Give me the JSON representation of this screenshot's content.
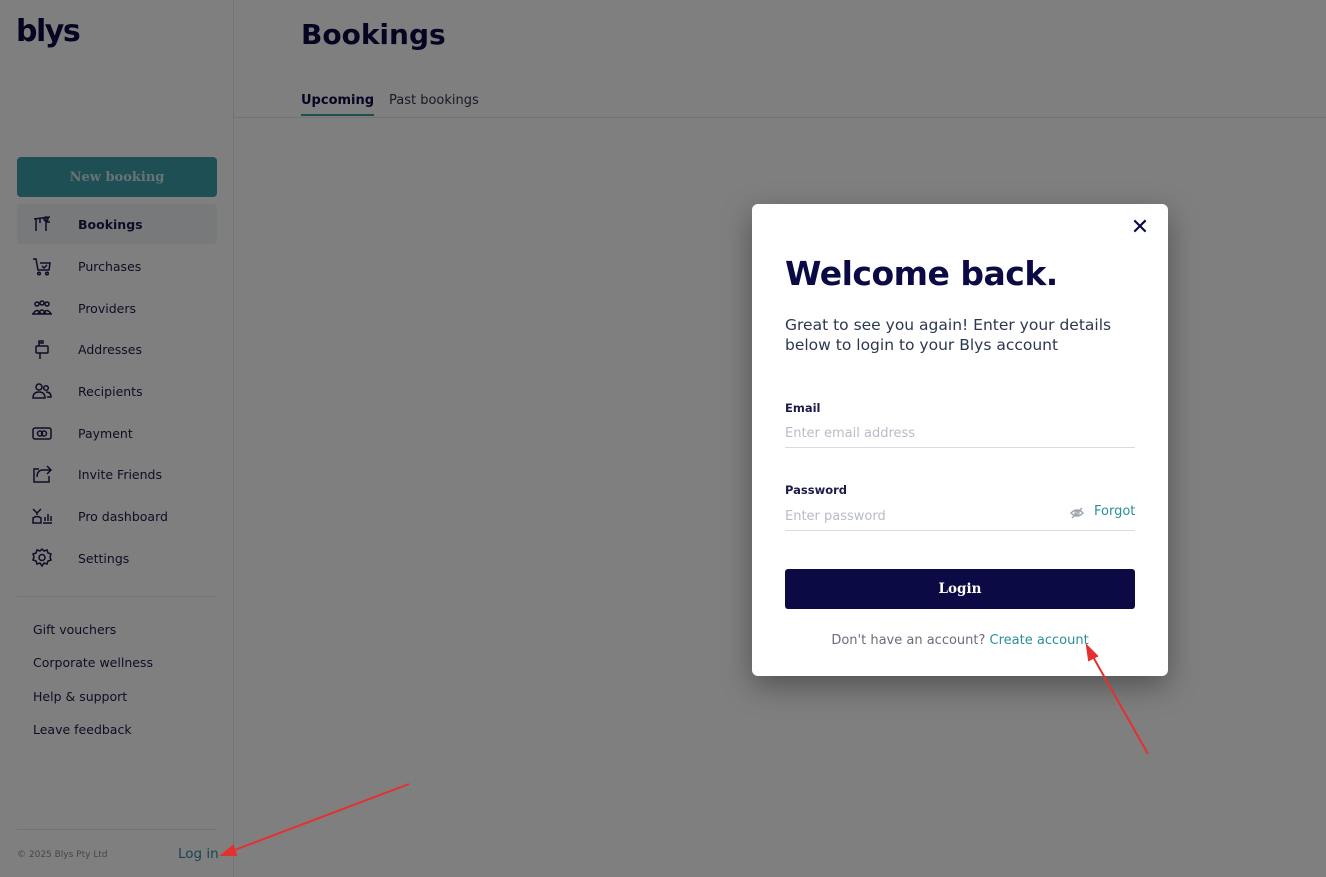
{
  "sidebar": {
    "logo": "blys",
    "new_booking": "New booking",
    "nav": [
      {
        "label": "Bookings",
        "icon": "bookings-icon",
        "active": true
      },
      {
        "label": "Purchases",
        "icon": "cart-icon"
      },
      {
        "label": "Providers",
        "icon": "providers-icon"
      },
      {
        "label": "Addresses",
        "icon": "mailbox-icon"
      },
      {
        "label": "Recipients",
        "icon": "recipients-icon"
      },
      {
        "label": "Payment",
        "icon": "payment-icon"
      },
      {
        "label": "Invite Friends",
        "icon": "share-icon"
      },
      {
        "label": "Pro dashboard",
        "icon": "dashboard-icon"
      },
      {
        "label": "Settings",
        "icon": "gear-icon"
      }
    ],
    "links": [
      "Gift vouchers",
      "Corporate wellness",
      "Help & support",
      "Leave feedback"
    ],
    "copyright": "© 2025 Blys Pty Ltd",
    "login": "Log in"
  },
  "main": {
    "title": "Bookings",
    "tabs": [
      {
        "label": "Upcoming",
        "active": true
      },
      {
        "label": "Past bookings"
      }
    ]
  },
  "modal": {
    "close": "✕",
    "title": "Welcome back.",
    "subtitle": "Great to see you again! Enter your details below to login to your Blys account",
    "email_label": "Email",
    "email_placeholder": "Enter email address",
    "password_label": "Password",
    "password_placeholder": "Enter password",
    "forgot": "Forgot",
    "login_button": "Login",
    "no_account": "Don't have an account?",
    "create_account": "Create account"
  },
  "colors": {
    "brand_navy": "#0b0a45",
    "brand_teal": "#3a9ea8",
    "annotation_red": "#e53030"
  }
}
